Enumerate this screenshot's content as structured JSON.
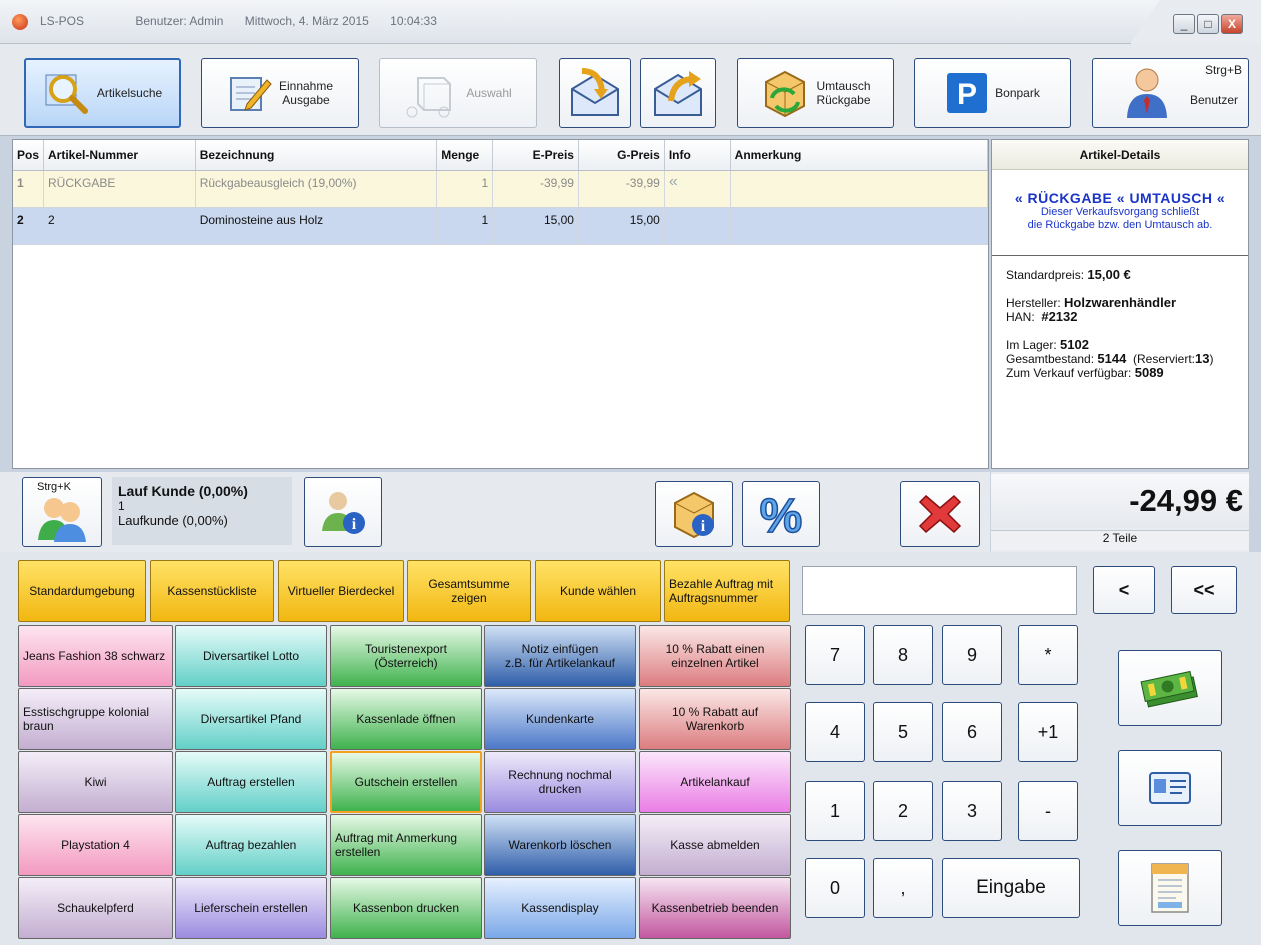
{
  "titlebar": {
    "app": "LS-POS",
    "user": "Benutzer: Admin",
    "date": "Mittwoch, 4. März 2015",
    "time": "10:04:33",
    "min": "_",
    "max": "□",
    "close": "X"
  },
  "toolbar": {
    "search": "Artikelsuche",
    "income": "Einnahme\nAusgabe",
    "select": "Auswahl",
    "exchange": "Umtausch\nRückgabe",
    "bonpark": "Bonpark",
    "user_shortcut": "Strg+B",
    "user": "Benutzer"
  },
  "grid": {
    "headers": [
      "Pos",
      "Artikel-Nummer",
      "Bezeichnung",
      "Menge",
      "E-Preis",
      "G-Preis",
      "Info",
      "Anmerkung"
    ],
    "rows": [
      {
        "pos": "1",
        "nr": "RÜCKGABE",
        "name": "Rückgabeausgleich (19,00%)",
        "qty": "1",
        "eprice": "-39,99",
        "gprice": "-39,99",
        "info": "«",
        "note": ""
      },
      {
        "pos": "2",
        "nr": "2",
        "name": "Dominosteine aus Holz",
        "qty": "1",
        "eprice": "15,00",
        "gprice": "15,00",
        "info": "",
        "note": ""
      }
    ]
  },
  "details": {
    "title": "Artikel-Details",
    "banner_line1": "« RÜCKGABE « UMTAUSCH «",
    "banner_line2": "Dieser Verkaufsvorgang schließt",
    "banner_line3": "die Rückgabe bzw. den Umtausch ab.",
    "std_label": "Standardpreis:",
    "std_value": "15,00 €",
    "maker_label": "Hersteller:",
    "maker_value": "Holzwarenhändler",
    "han_label": "HAN:",
    "han_value": "#2132",
    "stock_label": "Im Lager:",
    "stock_value": "5102",
    "total_label": "Gesamtbestand:",
    "total_value": "5144",
    "reserved_label": "(Reserviert:",
    "reserved_value": "13",
    "reserved_close": ")",
    "avail_label": "Zum Verkauf verfügbar:",
    "avail_value": "5089"
  },
  "customer": {
    "shortcut": "Strg+K",
    "name": "Lauf Kunde (0,00%)",
    "id": "1",
    "sub": "Laufkunde (0,00%)"
  },
  "summary": {
    "total": "-24,99 €",
    "items": "2 Teile"
  },
  "yellow_buttons": [
    "Standardumgebung",
    "Kassenstückliste",
    "Virtueller Bierdeckel",
    "Gesamtsumme\nzeigen",
    "Kunde wählen",
    "Bezahle Auftrag mit\nAuftragsnummer"
  ],
  "grid_buttons": [
    [
      "Jeans Fashion 38 schwarz",
      "Diversartikel Lotto",
      "Touristenexport\n(Österreich)",
      "Notiz einfügen\nz.B. für Artikelankauf",
      "10 % Rabatt einen\neinzelnen Artikel"
    ],
    [
      "Esstischgruppe kolonial\nbraun",
      "Diversartikel Pfand",
      "Kassenlade öffnen",
      "Kundenkarte",
      "10 % Rabatt auf\nWarenkorb"
    ],
    [
      "Kiwi",
      "Auftrag erstellen",
      "Gutschein erstellen",
      "Rechnung nochmal\ndrucken",
      "Artikelankauf"
    ],
    [
      "Playstation 4",
      "Auftrag bezahlen",
      "Auftrag mit Anmerkung\nerstellen",
      "Warenkorb löschen",
      "Kasse abmelden"
    ],
    [
      "Schaukelpferd",
      "Lieferschein erstellen",
      "Kassenbon drucken",
      "Kassendisplay",
      "Kassenbetrieb beenden"
    ]
  ],
  "keypad": {
    "back": "<",
    "clear": "<<",
    "keys": [
      "7",
      "8",
      "9",
      "*",
      "4",
      "5",
      "6",
      "+1",
      "1",
      "2",
      "3",
      "-",
      "0",
      ","
    ],
    "enter": "Eingabe"
  }
}
